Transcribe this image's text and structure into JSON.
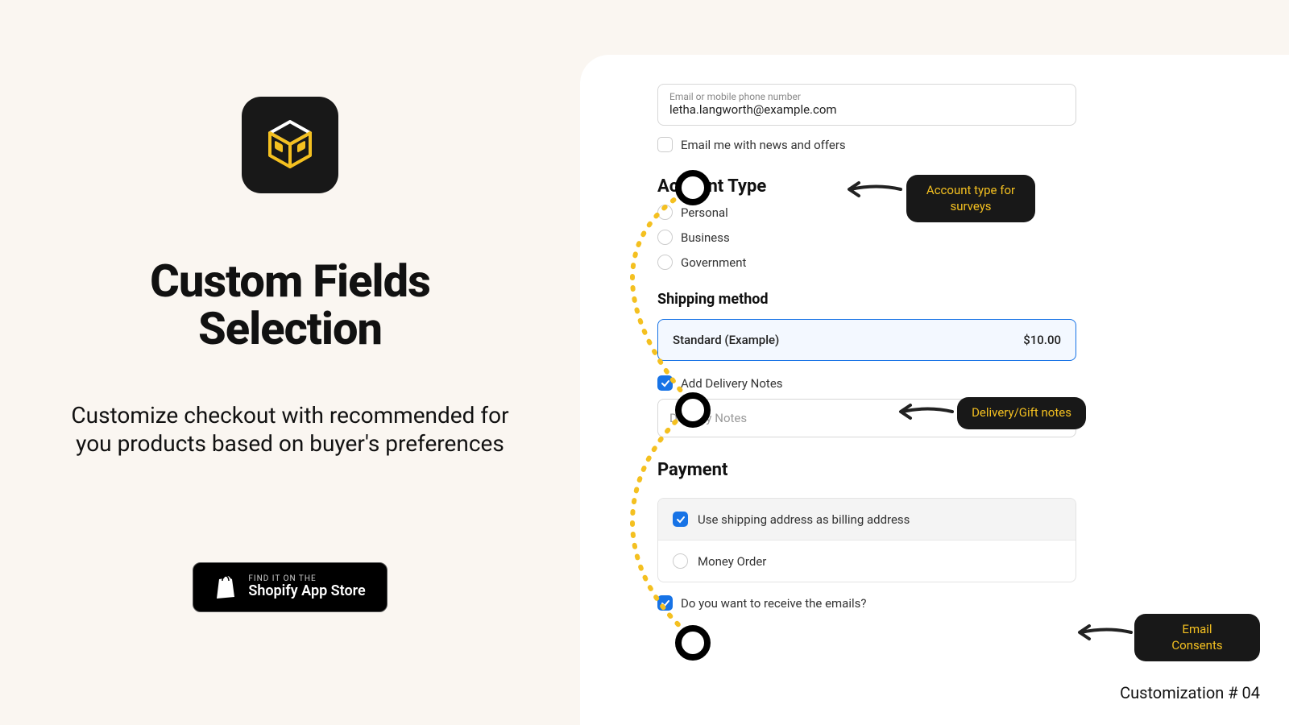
{
  "left": {
    "title_l1": "Custom Fields",
    "title_l2": "Selection",
    "desc": "Customize checkout with recommended for you products based on buyer's preferences",
    "badge_small": "FIND IT ON THE",
    "badge_big": "Shopify App Store"
  },
  "checkout": {
    "email_label": "Email or mobile phone number",
    "email_value": "letha.langworth@example.com",
    "news_optin": "Email me with news and offers",
    "account_h": "Account Type",
    "account_opts": [
      "Personal",
      "Business",
      "Government"
    ],
    "shipping_h": "Shipping method",
    "shipping_name": "Standard (Example)",
    "shipping_price": "$10.00",
    "add_notes": "Add Delivery Notes",
    "notes_ph": "Delivery Notes",
    "payment_h": "Payment",
    "billing_same": "Use shipping address as billing address",
    "money_order": "Money Order",
    "emails_optin": "Do you want to receive the emails?"
  },
  "callouts": {
    "account": "Account type for surveys",
    "notes": "Delivery/Gift notes",
    "emails_l1": "Email",
    "emails_l2": "Consents"
  },
  "footer": "Customization # 04"
}
